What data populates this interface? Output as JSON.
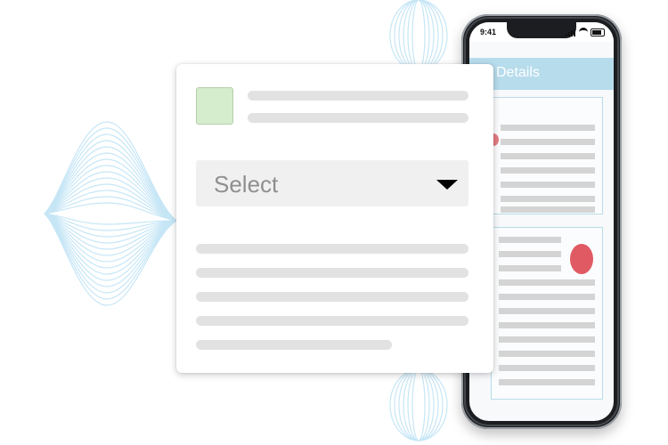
{
  "phone": {
    "status_time": "9:41",
    "header_title": "Details",
    "header_color": "#b7dcec",
    "accent_red": "#e05a64"
  },
  "card": {
    "thumbnail_color": "#d5eccd",
    "select": {
      "value": "Select",
      "icon": "caret-down-icon"
    }
  },
  "decoration": {
    "wave_color": "#bfe3f4"
  }
}
